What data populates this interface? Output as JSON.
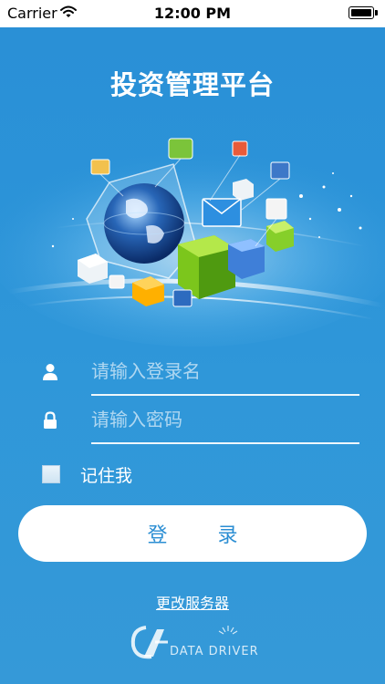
{
  "status_bar": {
    "carrier": "Carrier",
    "time": "12:00 PM"
  },
  "app": {
    "title": "投资管理平台"
  },
  "hero": {
    "illustration_icon": "globe-with-app-cubes-illustration"
  },
  "form": {
    "username_placeholder": "请输入登录名",
    "username_value": "",
    "username_icon": "user-icon",
    "password_placeholder": "请输入密码",
    "password_value": "",
    "password_icon": "lock-icon",
    "remember_label": "记住我",
    "remember_checked": false,
    "login_label": "登 录"
  },
  "links": {
    "change_server": "更改服务器"
  },
  "brand": {
    "logo_text": "DATA DRIVER"
  },
  "colors": {
    "background": "#2b93d8",
    "accent": "#2b8ed3"
  }
}
